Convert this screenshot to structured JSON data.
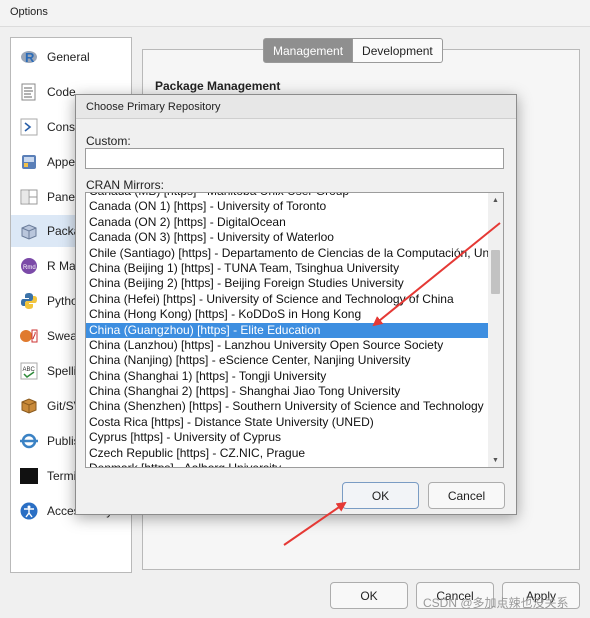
{
  "window": {
    "title": "Options"
  },
  "sidebar": {
    "items": [
      {
        "label": "General",
        "icon": "r-logo-icon"
      },
      {
        "label": "Code",
        "icon": "code-document-icon"
      },
      {
        "label": "Conso",
        "icon": "console-prompt-icon"
      },
      {
        "label": "Appe",
        "icon": "appearance-icon"
      },
      {
        "label": "Pane",
        "icon": "pane-layout-icon"
      },
      {
        "label": "Packa",
        "icon": "packages-box-icon"
      },
      {
        "label": "R Ma",
        "icon": "rmarkdown-icon"
      },
      {
        "label": "Pytho",
        "icon": "python-logo-icon"
      },
      {
        "label": "Sweav",
        "icon": "sweave-pdf-icon"
      },
      {
        "label": "Spelli",
        "icon": "spelling-abc-icon"
      },
      {
        "label": "Git/SV",
        "icon": "git-svn-icon"
      },
      {
        "label": "Publis",
        "icon": "publishing-icon"
      },
      {
        "label": "Termi",
        "icon": "terminal-icon"
      },
      {
        "label": "Accessibility",
        "icon": "accessibility-icon"
      }
    ],
    "active_index": 5
  },
  "tabs": {
    "management": "Management",
    "development": "Development"
  },
  "panel": {
    "heading": "Package Management"
  },
  "bottom_buttons": {
    "ok": "OK",
    "cancel": "Cancel",
    "apply": "Apply"
  },
  "dialog": {
    "title": "Choose Primary Repository",
    "custom_label": "Custom:",
    "custom_value": "",
    "mirrors_label": "CRAN Mirrors:",
    "mirrors": [
      "Canada (MB) [https] - Manitoba Unix User Group",
      "Canada (ON 1) [https] - University of Toronto",
      "Canada (ON 2) [https] - DigitalOcean",
      "Canada (ON 3) [https] - University of Waterloo",
      "Chile (Santiago) [https] - Departamento de Ciencias de la Computación, Un",
      "China (Beijing 1) [https] - TUNA Team, Tsinghua University",
      "China (Beijing 2) [https] - Beijing Foreign Studies University",
      "China (Hefei) [https] - University of Science and Technology of China",
      "China (Hong Kong) [https] - KoDDoS in Hong Kong",
      "China (Guangzhou) [https] - Elite Education",
      "China (Lanzhou) [https] - Lanzhou University Open Source Society",
      "China (Nanjing) [https] - eScience Center, Nanjing University",
      "China (Shanghai 1) [https] - Tongji University",
      "China (Shanghai 2) [https] - Shanghai Jiao Tong University",
      "China (Shenzhen) [https] - Southern University of Science and Technology",
      "Costa Rica [https] - Distance State University (UNED)",
      "Cyprus [https] - University of Cyprus",
      "Czech Republic [https] - CZ.NIC, Prague",
      "Denmark [https] - Aalborg University"
    ],
    "selected_index": 9,
    "ok_label": "OK",
    "cancel_label": "Cancel"
  },
  "watermark": "CSDN @多加点辣也没关系",
  "colors": {
    "selection": "#3d8ee0",
    "annotation_arrow": "#e53935",
    "active_tab": "#8f8f8f"
  }
}
